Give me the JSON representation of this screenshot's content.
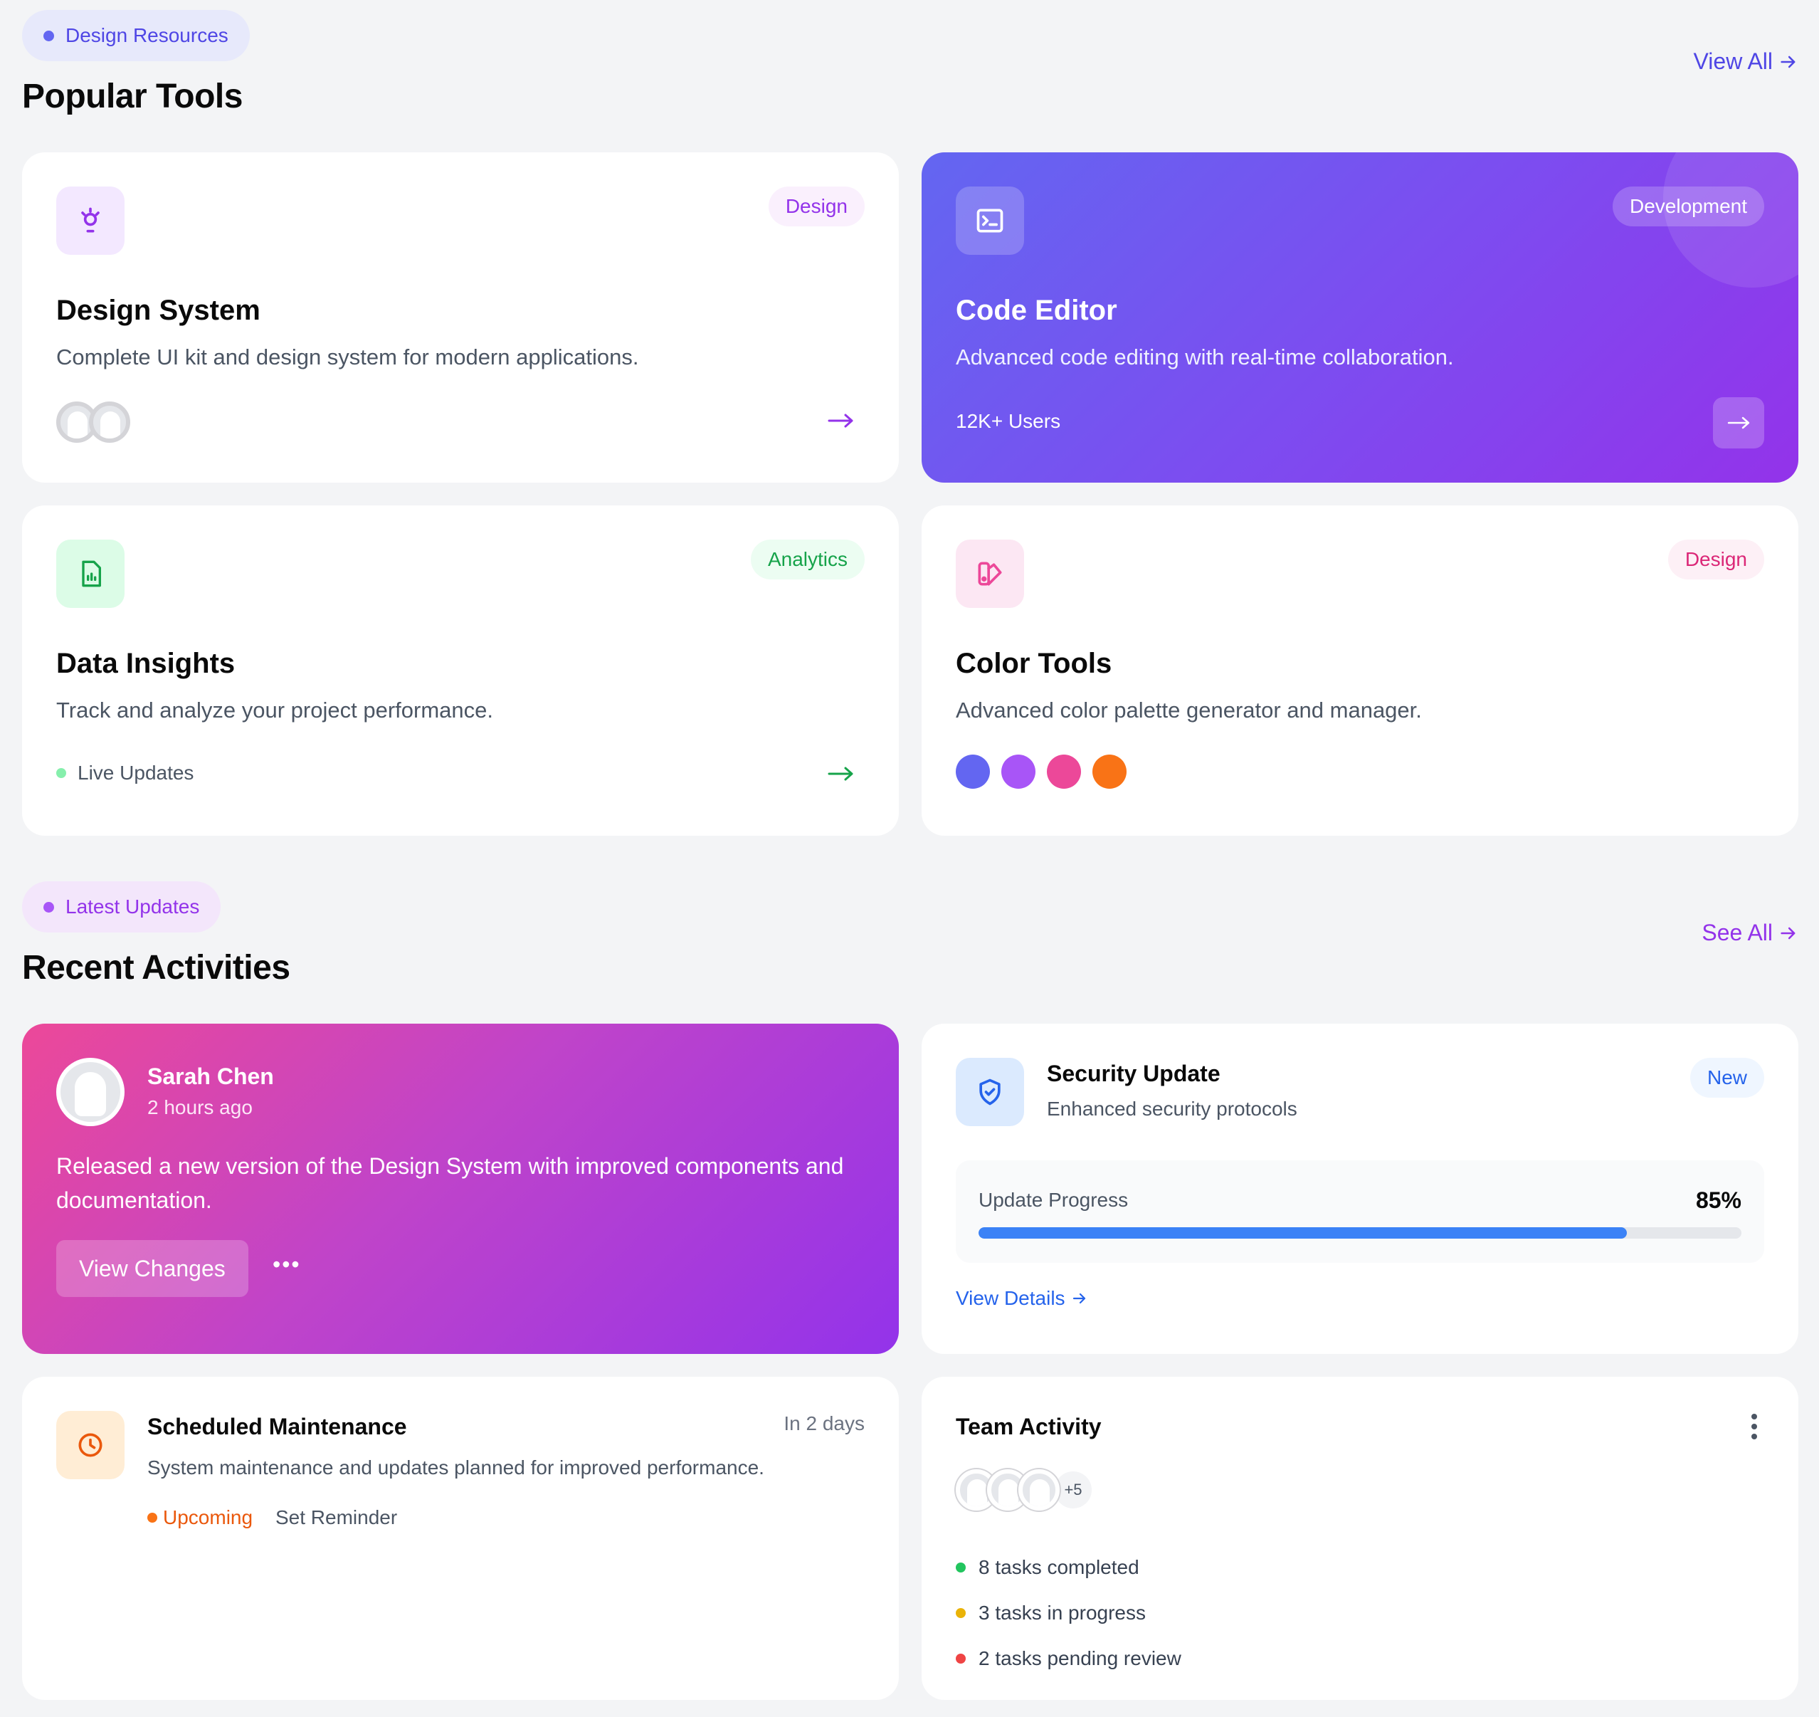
{
  "tools_section": {
    "pill": "Design Resources",
    "title": "Popular Tools",
    "view_all": "View All",
    "cards": {
      "design_system": {
        "tag": "Design",
        "title": "Design System",
        "desc": "Complete UI kit and design system for modern applications."
      },
      "code_editor": {
        "tag": "Development",
        "title": "Code Editor",
        "desc": "Advanced code editing with real-time collaboration.",
        "users": "12K+ Users"
      },
      "data_insights": {
        "tag": "Analytics",
        "title": "Data Insights",
        "desc": "Track and analyze your project performance.",
        "status": "Live Updates"
      },
      "color_tools": {
        "tag": "Design",
        "title": "Color Tools",
        "desc": "Advanced color palette generator and manager.",
        "swatches": [
          "#6366f1",
          "#a855f7",
          "#ec4899",
          "#f97316"
        ]
      }
    }
  },
  "activity_section": {
    "pill": "Latest Updates",
    "title": "Recent Activities",
    "see_all": "See All",
    "post": {
      "name": "Sarah Chen",
      "time": "2 hours ago",
      "text": "Released a new version of the Design System with improved components and documentation.",
      "button": "View Changes",
      "more": "•••"
    },
    "security": {
      "title": "Security Update",
      "subtitle": "Enhanced security protocols",
      "badge": "New",
      "progress_label": "Update Progress",
      "progress_value": "85%",
      "progress_fraction": 0.85,
      "link": "View Details"
    },
    "maintenance": {
      "title": "Scheduled Maintenance",
      "when": "In 2 days",
      "desc": "System maintenance and updates planned for improved performance.",
      "status": "Upcoming",
      "action": "Set Reminder"
    },
    "team": {
      "title": "Team Activity",
      "extra": "+5",
      "items": [
        {
          "text": "8 tasks completed",
          "color": "#22c55e"
        },
        {
          "text": "3 tasks in progress",
          "color": "#eab308"
        },
        {
          "text": "2 tasks pending review",
          "color": "#ef4444"
        }
      ]
    }
  },
  "colors": {
    "indigo": "#6366f1",
    "purple": "#9333ea",
    "green": "#22c55e",
    "pink": "#ec4899",
    "blue": "#3b82f6",
    "orange": "#f97316"
  }
}
